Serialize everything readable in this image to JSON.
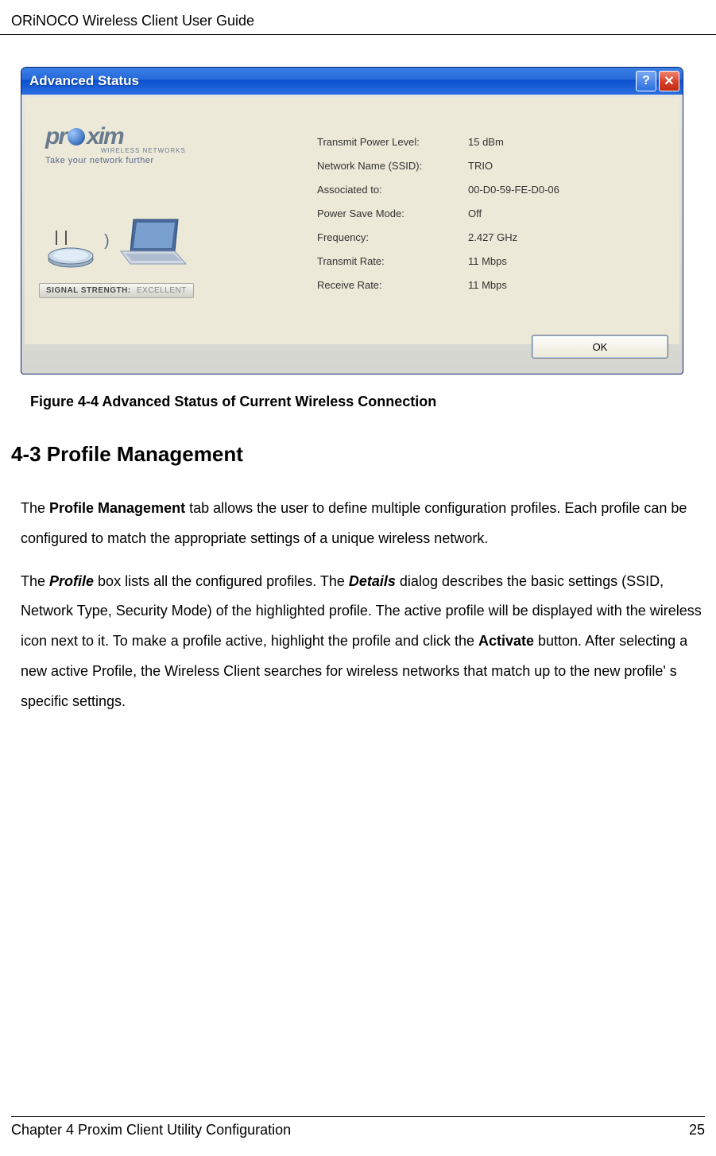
{
  "page_header": "ORiNOCO Wireless Client User Guide",
  "dialog": {
    "title": "Advanced Status",
    "logo": {
      "brand_letters_left": "pr",
      "brand_letters_right": "xim",
      "subbrand": "WIRELESS NETWORKS"
    },
    "tagline": "Take your network further",
    "signal": {
      "label": "SIGNAL STRENGTH:",
      "value": "EXCELLENT"
    },
    "stats": [
      {
        "label": "Transmit Power Level:",
        "value": "15 dBm"
      },
      {
        "label": "Network Name (SSID):",
        "value": "TRIO"
      },
      {
        "label": "Associated  to:",
        "value": "00-D0-59-FE-D0-06"
      },
      {
        "label": "Power Save Mode:",
        "value": "Off"
      },
      {
        "label": "Frequency:",
        "value": "2.427 GHz"
      },
      {
        "label": "Transmit Rate:",
        "value": "11 Mbps"
      },
      {
        "label": "Receive Rate:",
        "value": "11 Mbps"
      }
    ],
    "ok_label": "OK"
  },
  "figure_caption": "Figure 4-4  Advanced Status of Current Wireless Connection",
  "section_heading": "4-3 Profile Management",
  "para1_pre": "The ",
  "para1_bold": "Profile Management",
  "para1_post": " tab allows the user to define multiple configuration profiles. Each profile can be configured to match the appropriate settings of a unique wireless network.",
  "p2_a": "The ",
  "p2_profile": "Profile",
  "p2_b": " box lists all the configured profiles. The ",
  "p2_details": "Details",
  "p2_c": " dialog describes the basic settings (SSID, Network Type, Security Mode) of the highlighted profile. The active profile will be displayed with the wireless icon next to it. To make a profile active, highlight the profile and click the ",
  "p2_activate": "Activate",
  "p2_d": " button. After selecting a new active Profile, the Wireless Client searches for wireless networks that match up to the new profile' s specific settings.",
  "footer_left": "Chapter 4 Proxim Client Utility Configuration",
  "footer_right": "25"
}
